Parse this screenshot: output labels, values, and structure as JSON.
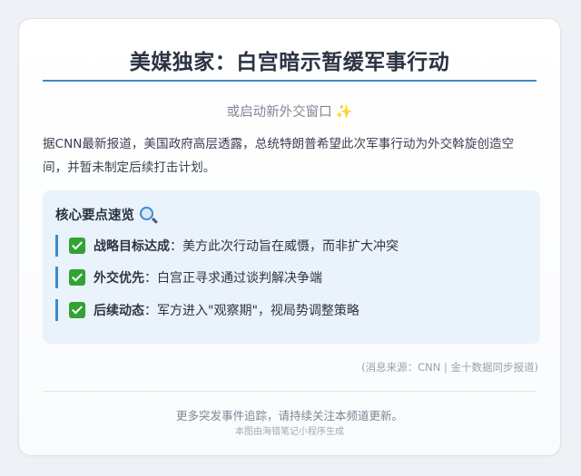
{
  "title": "美媒独家：白宫暗示暂缓军事行动",
  "subtitle": "或启动新外交窗口",
  "subtitle_icon": "sparkles-icon",
  "lead": "据CNN最新报道，美国政府高层透露，总统特朗普希望此次军事行动为外交斡旋创造空间，并暂未制定后续打击计划。",
  "key_points": {
    "title": "核心要点速览",
    "title_icon": "magnifier-icon",
    "items": [
      {
        "label": "战略目标达成",
        "separator": "：",
        "text": "美方此次行动旨在威慑，而非扩大冲突"
      },
      {
        "label": "外交优先",
        "separator": "：",
        "text": "白宫正寻求通过谈判解决争端"
      },
      {
        "label": "后续动态",
        "separator": "：",
        "text": "军方进入\"观察期\"，视局势调整策略"
      }
    ]
  },
  "source": "(消息来源：CNN | 金十数据同步报道)",
  "footer": {
    "main": "更多突发事件追踪，请持续关注本频道更新。",
    "sub": "本图由海错笔记小程序生成"
  },
  "colors": {
    "accent": "#3d8bcf",
    "check": "#33a233",
    "panel": "#eaf2fb"
  }
}
